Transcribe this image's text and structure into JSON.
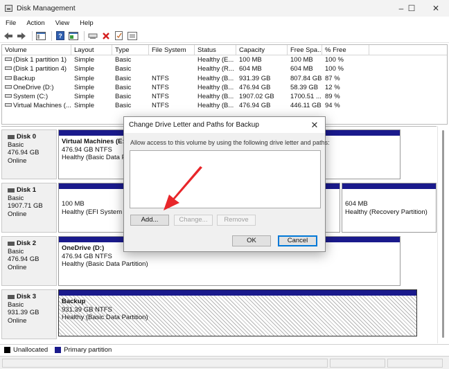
{
  "window": {
    "title": "Disk Management",
    "controls": [
      "–",
      "☐",
      "✕"
    ]
  },
  "menu": [
    "File",
    "Action",
    "View",
    "Help"
  ],
  "toolbar": {
    "icons": [
      "back-icon",
      "forward-icon",
      "console-tree-icon",
      "help-icon",
      "properties-icon",
      "connect-icon",
      "delete-icon",
      "check-icon",
      "list-view-icon"
    ],
    "delete_color": "#d42020"
  },
  "volume_table": {
    "headers": [
      "Volume",
      "Layout",
      "Type",
      "File System",
      "Status",
      "Capacity",
      "Free Spa...",
      "% Free"
    ],
    "rows": [
      [
        "(Disk 1 partition 1)",
        "Simple",
        "Basic",
        "",
        "Healthy (E...",
        "100 MB",
        "100 MB",
        "100 %"
      ],
      [
        "(Disk 1 partition 4)",
        "Simple",
        "Basic",
        "",
        "Healthy (R...",
        "604 MB",
        "604 MB",
        "100 %"
      ],
      [
        "Backup",
        "Simple",
        "Basic",
        "NTFS",
        "Healthy (B...",
        "931.39 GB",
        "807.84 GB",
        "87 %"
      ],
      [
        "OneDrive (D:)",
        "Simple",
        "Basic",
        "NTFS",
        "Healthy (B...",
        "476.94 GB",
        "58.39 GB",
        "12 %"
      ],
      [
        "System (C:)",
        "Simple",
        "Basic",
        "NTFS",
        "Healthy (B...",
        "1907.02 GB",
        "1700.51 ...",
        "89 %"
      ],
      [
        "Virtual Machines (...",
        "Simple",
        "Basic",
        "NTFS",
        "Healthy (B...",
        "476.94 GB",
        "446.11 GB",
        "94 %"
      ]
    ]
  },
  "disks": [
    {
      "name": "Disk 0",
      "type": "Basic",
      "size": "476.94 GB",
      "state": "Online",
      "partition": {
        "title": "Virtual Machines  (E:)",
        "size": "476.94 GB NTFS",
        "status": "Healthy (Basic Data Partition)"
      }
    },
    {
      "name": "Disk 1",
      "type": "Basic",
      "size": "1907.71 GB",
      "state": "Online",
      "efi": {
        "size": "100 MB",
        "status": "Healthy (EFI System P"
      },
      "recovery": {
        "size": "604 MB",
        "status": "Healthy (Recovery Partition)"
      }
    },
    {
      "name": "Disk 2",
      "type": "Basic",
      "size": "476.94 GB",
      "state": "Online",
      "partition": {
        "title": "OneDrive  (D:)",
        "size": "476.94 GB NTFS",
        "status": "Healthy (Basic Data Partition)"
      }
    },
    {
      "name": "Disk 3",
      "type": "Basic",
      "size": "931.39 GB",
      "state": "Online",
      "partition": {
        "title": "Backup",
        "size": "931.39 GB NTFS",
        "status": "Healthy (Basic Data Partition)"
      }
    }
  ],
  "legend": {
    "unallocated": {
      "label": "Unallocated",
      "color": "#000000"
    },
    "primary": {
      "label": "Primary partition",
      "color": "#1a1a8c"
    }
  },
  "dialog": {
    "title": "Change Drive Letter and Paths for Backup",
    "instruction": "Allow access to this volume by using the following drive letter and paths:",
    "buttons": {
      "add": "Add...",
      "change": "Change...",
      "remove": "Remove",
      "ok": "OK",
      "cancel": "Cancel"
    },
    "highlight_color": "#e8262a"
  }
}
